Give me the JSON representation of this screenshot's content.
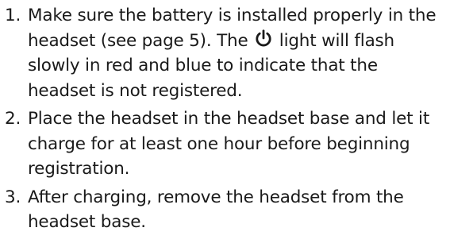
{
  "steps": [
    {
      "number": "1.",
      "text_before_icon": "Make sure the battery is installed properly in the headset (see page 5). The",
      "icon": "power-icon",
      "text_after_icon": "light will flash slowly in red and blue to indicate that the headset is not registered."
    },
    {
      "number": "2.",
      "text": "Place the headset in the headset base and let it charge for at least one hour before beginning registration."
    },
    {
      "number": "3.",
      "text": "After charging, remove the headset from the headset base."
    }
  ]
}
